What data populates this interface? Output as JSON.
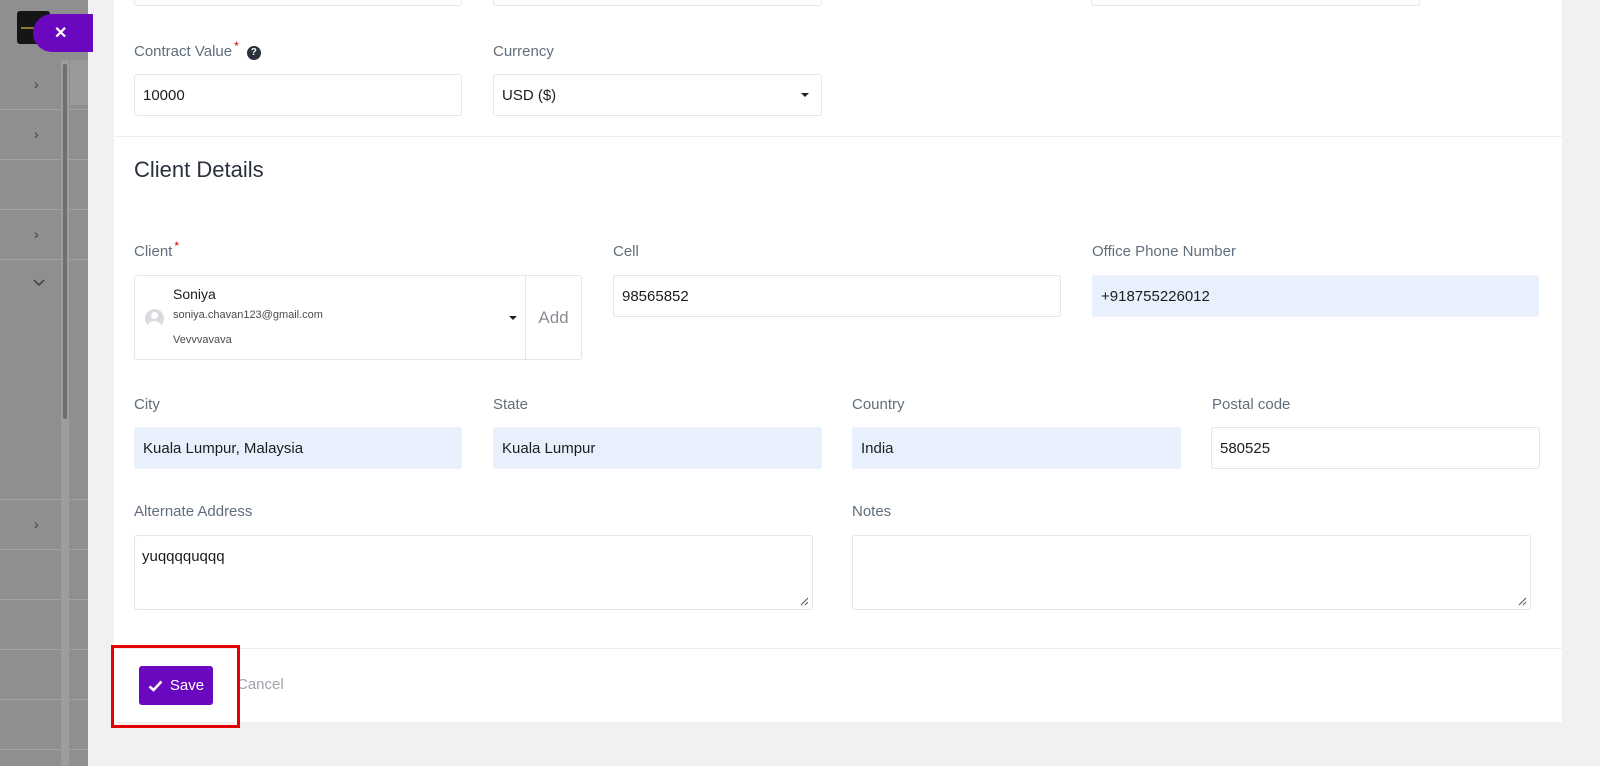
{
  "contract": {
    "contract_value_label": "Contract Value",
    "required_mark": "*",
    "help_icon": "question-circle-icon",
    "contract_value": "10000",
    "currency_label": "Currency",
    "currency_value": "USD ($)"
  },
  "client_details": {
    "title": "Client Details",
    "client_label": "Client",
    "client_name": "Soniya",
    "client_email": "soniya.chavan123@gmail.com",
    "client_company": "Vevvvavava",
    "add_label": "Add",
    "cell_label": "Cell",
    "cell_value": "98565852",
    "office_phone_label": "Office Phone Number",
    "office_phone_value": "+918755226012",
    "city_label": "City",
    "city_value": "Kuala Lumpur, Malaysia",
    "state_label": "State",
    "state_value": "Kuala Lumpur",
    "country_label": "Country",
    "country_value": "India",
    "postal_label": "Postal code",
    "postal_value": "580525",
    "alt_address_label": "Alternate Address",
    "alt_address_value": "yuqqqquqqq",
    "notes_label": "Notes",
    "notes_value": ""
  },
  "actions": {
    "save_label": "Save",
    "cancel_label": "Cancel"
  },
  "colors": {
    "accent": "#6a08bf",
    "highlight": "#e60000",
    "autofill": "#e8f0fe"
  }
}
